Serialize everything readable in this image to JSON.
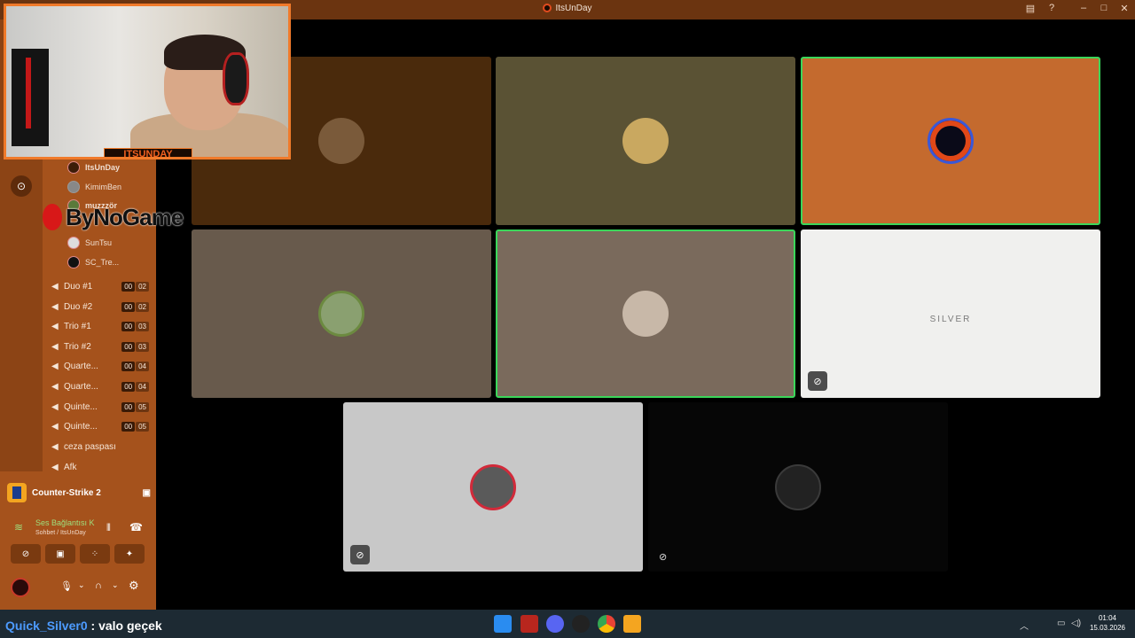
{
  "window": {
    "title": "ItsUnDay"
  },
  "overlay": {
    "cam_label": "ITSUNDAY",
    "brand": "ByNoGame"
  },
  "sidebar": {
    "voice_users": [
      {
        "name": "ItsUnDay"
      },
      {
        "name": "KimimBen"
      },
      {
        "name": "muzzzör"
      },
      {
        "name": "SunTsu"
      },
      {
        "name": "SC_Tre..."
      }
    ],
    "channels": [
      {
        "name": "Duo #1",
        "count": "00",
        "limit": "02"
      },
      {
        "name": "Duo #2",
        "count": "00",
        "limit": "02"
      },
      {
        "name": "Trio #1",
        "count": "00",
        "limit": "03"
      },
      {
        "name": "Trio #2",
        "count": "00",
        "limit": "03"
      },
      {
        "name": "Quarte...",
        "count": "00",
        "limit": "04"
      },
      {
        "name": "Quarte...",
        "count": "00",
        "limit": "04"
      },
      {
        "name": "Quinte...",
        "count": "00",
        "limit": "05"
      },
      {
        "name": "Quinte...",
        "count": "00",
        "limit": "05"
      },
      {
        "name": "ceza paspası"
      },
      {
        "name": "Afk"
      }
    ],
    "game": "Counter-Strike 2",
    "voice_status": "Ses Bağlantısı K",
    "voice_location": "Sohbet / ItsUnDay"
  },
  "tiles": {
    "silver_label": "SILVER"
  },
  "chat": {
    "user": "Quick_Silver0",
    "sep": " : ",
    "message": "valo geçek"
  },
  "taskbar": {
    "time": "01:04",
    "date": "15.03.2026"
  },
  "colors": {
    "accent": "#f07a2a",
    "speaking": "#3bd65a",
    "sidebar": "#a5521c"
  }
}
